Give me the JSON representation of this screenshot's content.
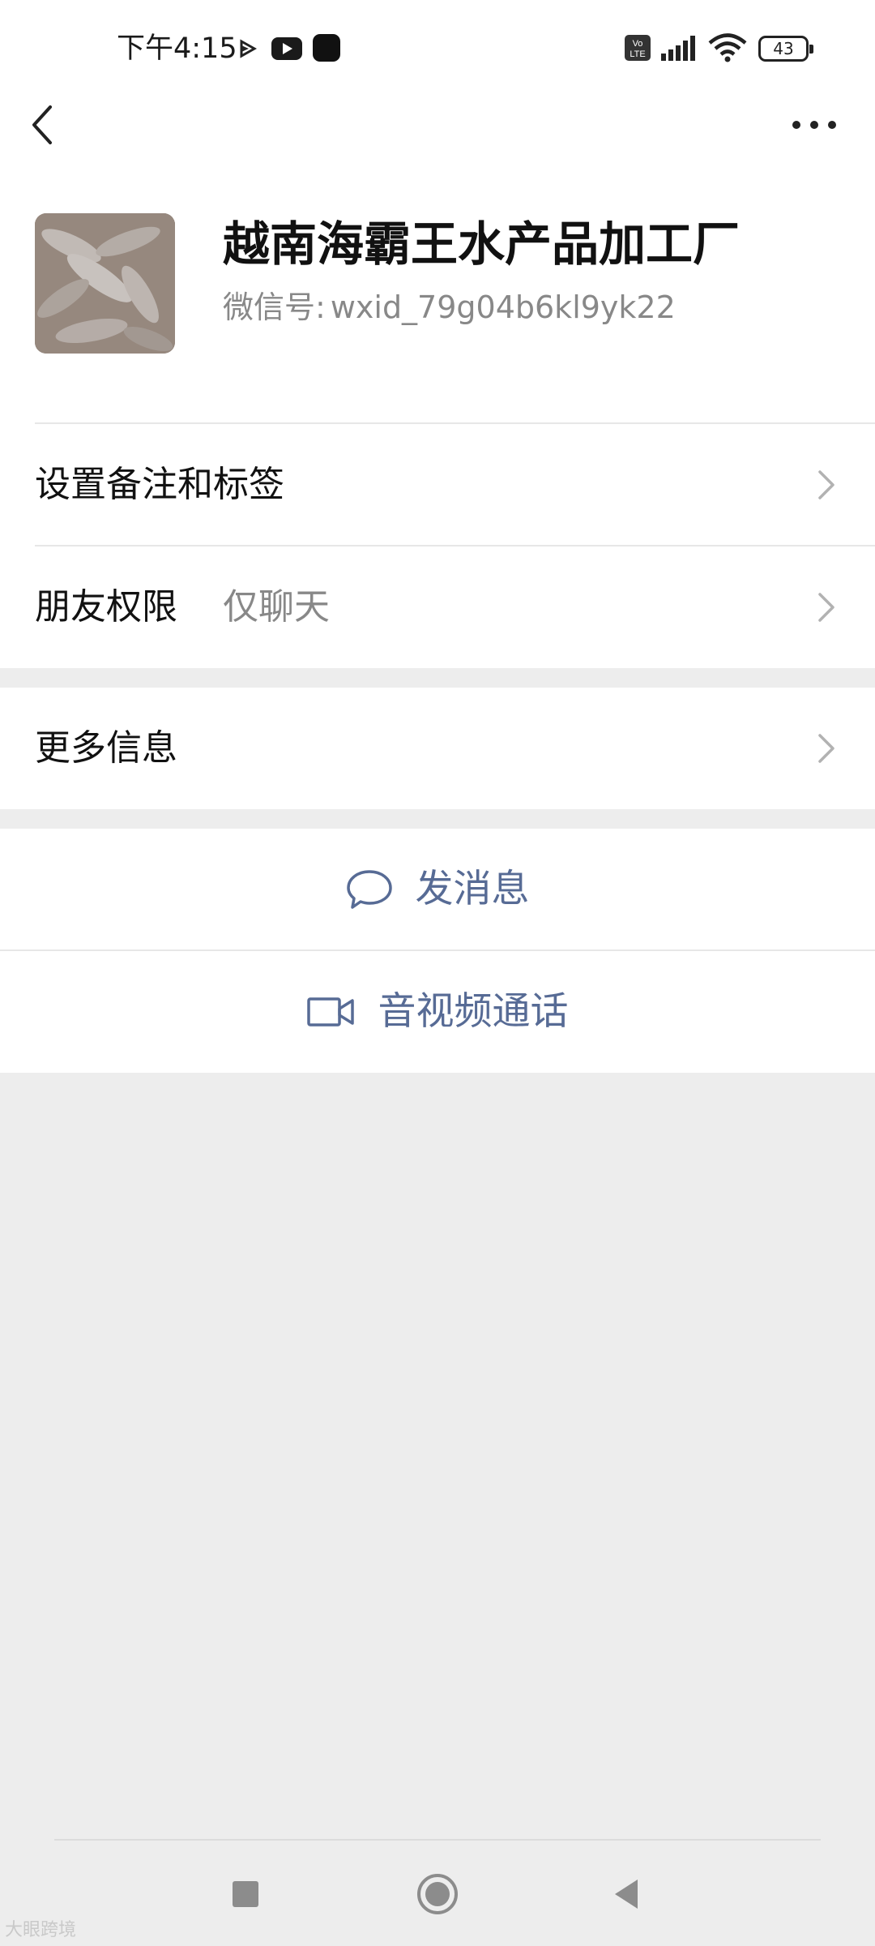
{
  "status_bar": {
    "time": "下午4:15",
    "battery": "43",
    "icons": [
      "play-arrow-icon",
      "youtube-icon",
      "app-icon",
      "volte-icon",
      "signal-icon",
      "wifi-icon",
      "battery-icon"
    ]
  },
  "nav": {
    "back_icon": "back-chevron-icon",
    "more_icon": "more-dots-icon"
  },
  "profile": {
    "name": "越南海霸王水产品加工厂",
    "id_prefix": "微信号:",
    "id": "wxid_79g04b6kl9yk22"
  },
  "rows": {
    "remark": {
      "label": "设置备注和标签"
    },
    "permission": {
      "label": "朋友权限",
      "value": "仅聊天"
    },
    "more_info": {
      "label": "更多信息"
    }
  },
  "actions": {
    "message": {
      "label": "发消息",
      "icon": "chat-bubble-icon"
    },
    "call": {
      "label": "音视频通话",
      "icon": "video-camera-icon"
    }
  },
  "colors": {
    "link_blue": "#576b95",
    "background_gray": "#ededed",
    "secondary_text": "#888888"
  },
  "system_nav": {
    "icons": [
      "recent-apps-square-icon",
      "home-circle-icon",
      "back-triangle-icon"
    ]
  },
  "watermark": "大眼跨境"
}
